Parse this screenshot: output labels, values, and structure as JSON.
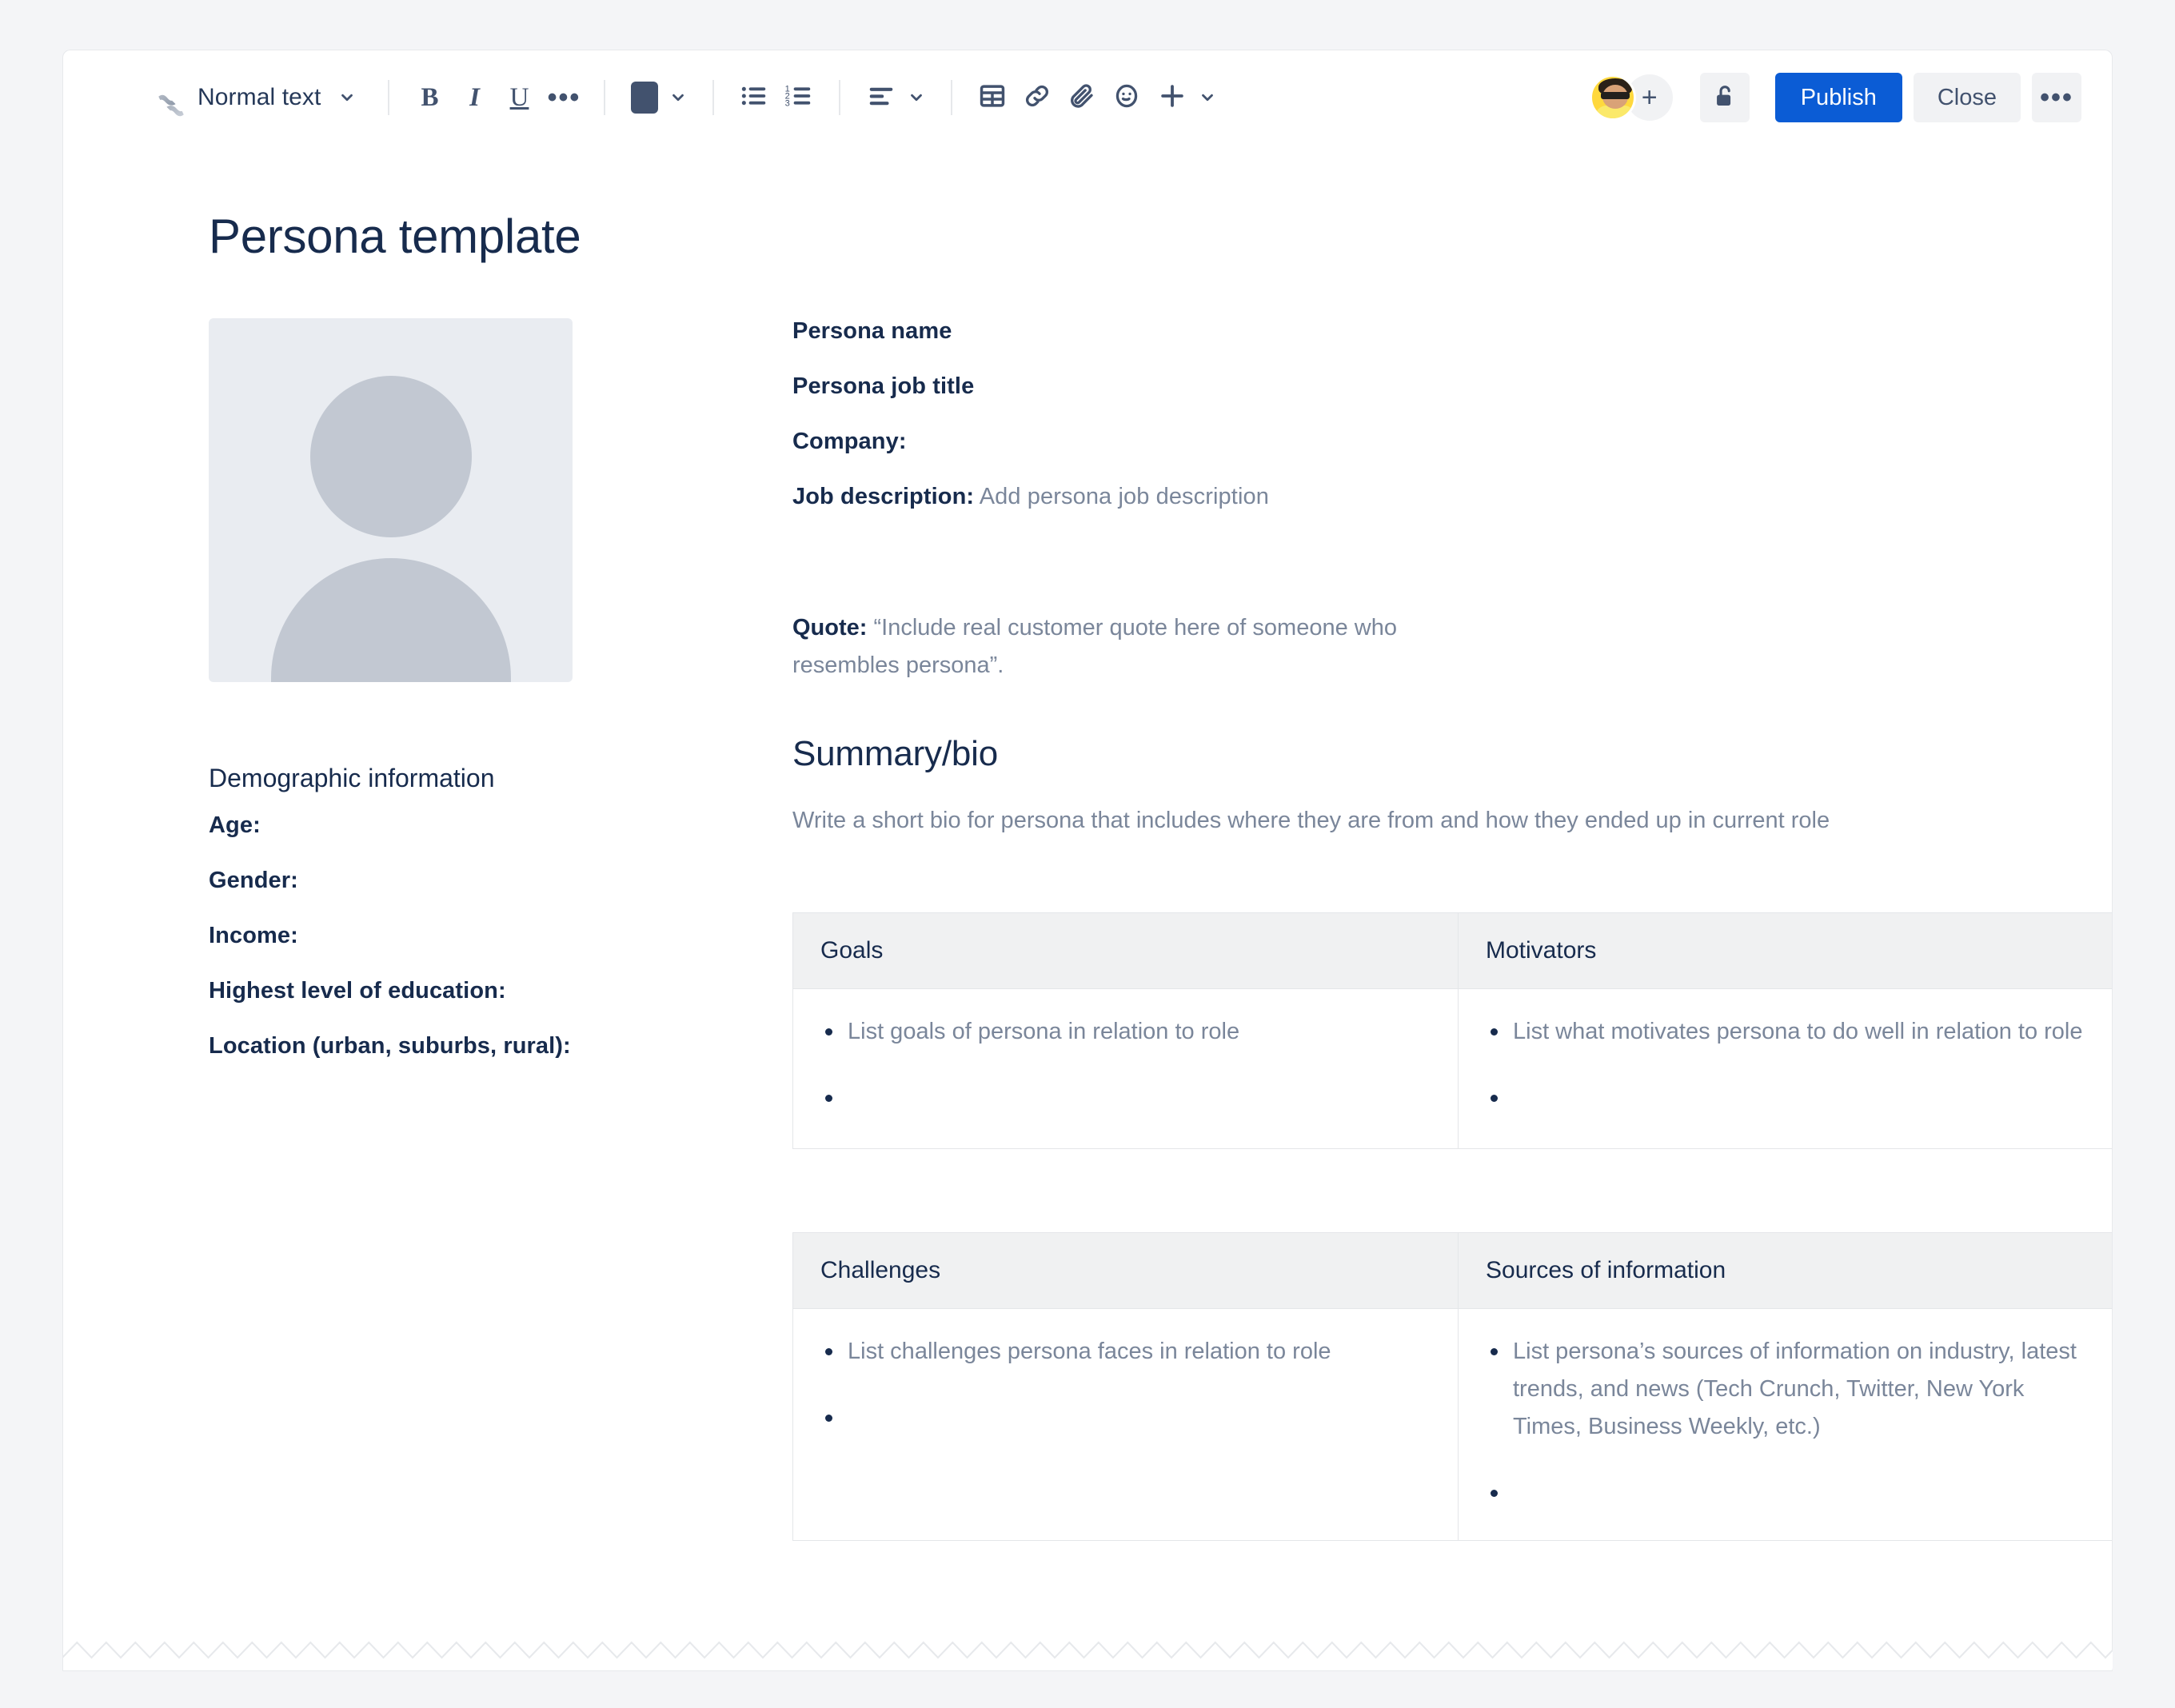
{
  "toolbar": {
    "logo_name": "confluence-logo",
    "style_select": {
      "value": "Normal text"
    },
    "buttons": {
      "bold": "B",
      "italic": "I",
      "underline": "U",
      "more_formatting": "•••",
      "text_color": "text-color",
      "bullet_list": "bullet-list",
      "numbered_list": "numbered-list",
      "text_align": "text-align",
      "table": "table",
      "link": "link",
      "attachment": "attachment",
      "emoji": "emoji",
      "insert": "insert-more"
    },
    "text_color_value": "#42526E",
    "avatar_label": "avatar",
    "add_people_label": "+",
    "restrictions_label": "unlock",
    "publish_label": "Publish",
    "close_label": "Close",
    "more_label": "•••"
  },
  "colors": {
    "accent": "#0B5CD5",
    "text": "#172B4D",
    "placeholder": "#7A869A",
    "table_header_bg": "#F0F1F2",
    "page_bg": "#F4F5F7"
  },
  "document": {
    "title": "Persona template",
    "persona": {
      "photo_alt": "persona-photo-placeholder",
      "name": "Persona name",
      "job_title": "Persona job title",
      "company_label": "Company:",
      "job_description_label": "Job description:",
      "job_description_placeholder": "Add persona job description",
      "quote_label": "Quote:",
      "quote_placeholder": "“Include real customer quote here of someone who resembles persona”."
    },
    "demographics": {
      "heading": "Demographic information",
      "items": [
        "Age:",
        "Gender:",
        "Income:",
        "Highest level of education:",
        "Location (urban, suburbs, rural):"
      ]
    },
    "summary": {
      "heading": "Summary/bio",
      "placeholder": "Write a short bio for persona that includes where they are from and how they ended up in current role"
    },
    "tables": [
      {
        "headers": [
          "Goals",
          "Motivators"
        ],
        "columns": [
          [
            "List goals of persona in relation to role",
            ""
          ],
          [
            "List what motivates persona to do well in relation to role",
            ""
          ]
        ]
      },
      {
        "headers": [
          "Challenges",
          "Sources of information"
        ],
        "columns": [
          [
            "List challenges persona faces in relation to role",
            ""
          ],
          [
            "List persona’s sources of information on industry, latest trends, and news (Tech Crunch, Twitter, New York Times, Business Weekly, etc.)",
            ""
          ]
        ]
      }
    ]
  }
}
